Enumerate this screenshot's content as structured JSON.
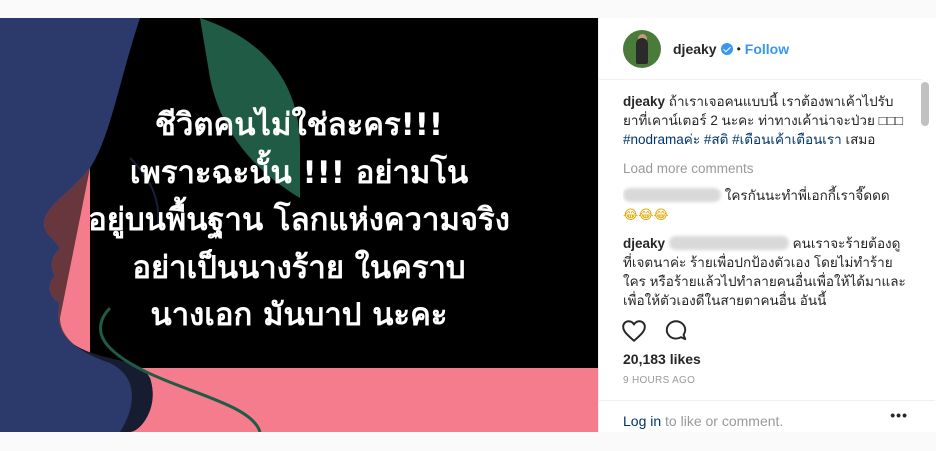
{
  "post": {
    "image_text": [
      "ชีวิตคนไม่ใช่ละคร!!!",
      "เพราะฉะนั้น !!! อย่ามโน",
      "อยู่บนพื้นฐาน โลกแห่งความจริง",
      "อย่าเป็นนางร้าย ในคราบ",
      "นางเอก มันบาป นะคะ"
    ],
    "colors": {
      "pink": "#f47c8c",
      "navy": "#2b3a6b",
      "green": "#1f5b45",
      "black": "#000000"
    }
  },
  "header": {
    "username": "djeaky",
    "separator": "•",
    "follow_label": "Follow"
  },
  "caption": {
    "username": "djeaky",
    "text": "ถ้าเราเจอคนแบบนี้ เราต้องพาเค้าไปรับยาที่เคาน์เตอร์ 2 นะคะ ท่าทางเค้าน่าจะป่วย □□□ ",
    "tags": [
      "#nodramaค่ะ",
      "#สติ",
      "#เตือนเค้าเตือนเรา"
    ],
    "tail": "เสมอ"
  },
  "load_more": "Load more comments",
  "comments": [
    {
      "text": "ใครกันนะทำพี่เอกกี้เราจี๊ดดด",
      "emoji": "😂😂😂"
    },
    {
      "username": "djeaky",
      "text": "คนเราจะร้ายต้องดูที่เจตนาค่ะ ร้ายเพื่อปกป้องตัวเอง โดยไม่ทำร้ายใคร หรือร้ายแล้วไปทำลายคนอื่นเพื่อให้ได้มาและเพื่อให้ตัวเองดีในสายตาคนอื่น อันนี้"
    }
  ],
  "likes": "20,183 likes",
  "timestamp": "9 HOURS AGO",
  "footer": {
    "login_link": "Log in",
    "login_rest": " to like or comment.",
    "more": "•••"
  }
}
